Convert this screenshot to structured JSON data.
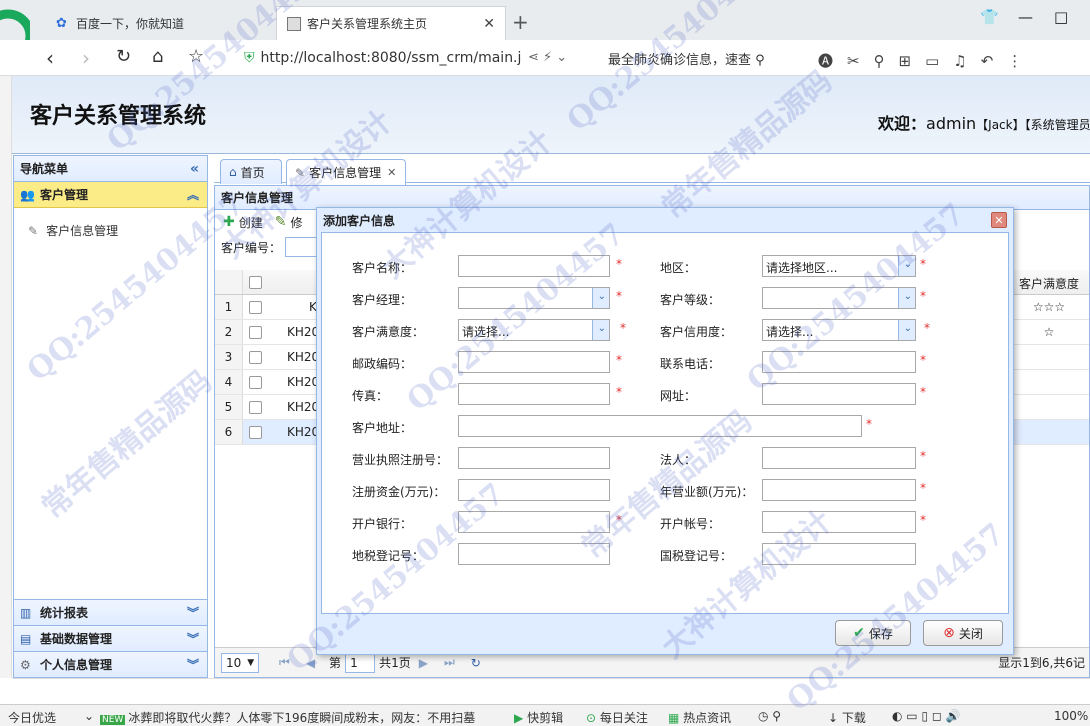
{
  "browser": {
    "tabs": [
      {
        "label": "百度一下，你就知道"
      },
      {
        "label": "客户关系管理系统主页"
      }
    ],
    "new_tab_symbol": "+",
    "url": "http://localhost:8080/ssm_crm/main.j",
    "search_text": "最全肺炎确诊信息，速查",
    "controls": {
      "restore": "⬒",
      "minimize": "—",
      "maximize": "□"
    }
  },
  "app": {
    "title": "客户关系管理系统",
    "welcome_label": "欢迎：",
    "user": "admin",
    "role_user": "【Jack】",
    "role_system": "【系统管理员】"
  },
  "nav": {
    "title": "导航菜单",
    "sections": [
      {
        "label": "客户管理",
        "active": true,
        "items": [
          "客户信息管理"
        ]
      },
      {
        "label": "统计报表",
        "active": false
      },
      {
        "label": "基础数据管理",
        "active": false
      },
      {
        "label": "个人信息管理",
        "active": false
      }
    ]
  },
  "main": {
    "tabs": [
      {
        "label": "首页"
      },
      {
        "label": "客户信息管理"
      }
    ],
    "panel_title": "客户信息管理",
    "toolbar": {
      "create": "创建",
      "edit": "修"
    },
    "search_label": "客户编号：",
    "grid": {
      "header_last": "客户满意度",
      "rows": [
        {
          "num": "1",
          "code": "K",
          "sat": "☆☆☆"
        },
        {
          "num": "2",
          "code": "KH20",
          "sat": "☆"
        },
        {
          "num": "3",
          "code": "KH20",
          "sat": ""
        },
        {
          "num": "4",
          "code": "KH20",
          "sat": ""
        },
        {
          "num": "5",
          "code": "KH20",
          "sat": ""
        },
        {
          "num": "6",
          "code": "KH20",
          "sat": ""
        }
      ]
    },
    "pager": {
      "page_size": "10",
      "page_label": "第",
      "page_value": "1",
      "page_total": "共1页",
      "info": "显示1到6,共6记"
    }
  },
  "dialog": {
    "title": "添加客户信息",
    "fields": {
      "name": "客户名称：",
      "area": "地区：",
      "area_value": "请选择地区...",
      "manager": "客户经理：",
      "level": "客户等级：",
      "satisfaction": "客户满意度：",
      "satisfaction_value": "请选择...",
      "credit": "客户信用度：",
      "credit_value": "请选择...",
      "postcode": "邮政编码：",
      "phone": "联系电话：",
      "fax": "传真：",
      "website": "网址：",
      "address": "客户地址：",
      "license": "营业执照注册号：",
      "legal": "法人：",
      "capital": "注册资金(万元)：",
      "turnover": "年营业额(万元)：",
      "bank": "开户银行：",
      "account": "开户帐号：",
      "local_tax": "地税登记号：",
      "national_tax": "国税登记号："
    },
    "required_mark": "*",
    "save": "保存",
    "close": "关闭"
  },
  "statusbar": {
    "left": "今日优选",
    "news_badge": "NEW",
    "news": "冰葬即将取代火葬？人体零下196度瞬间成粉末，网友：不用扫墓",
    "clip": "快剪辑",
    "daily": "每日关注",
    "hot": "热点资讯",
    "download": "下载",
    "zoom": "100%"
  },
  "watermark": {
    "qq": "QQ:2545404457",
    "shop": "常年售精品源码",
    "design": "大神计算机设计"
  }
}
